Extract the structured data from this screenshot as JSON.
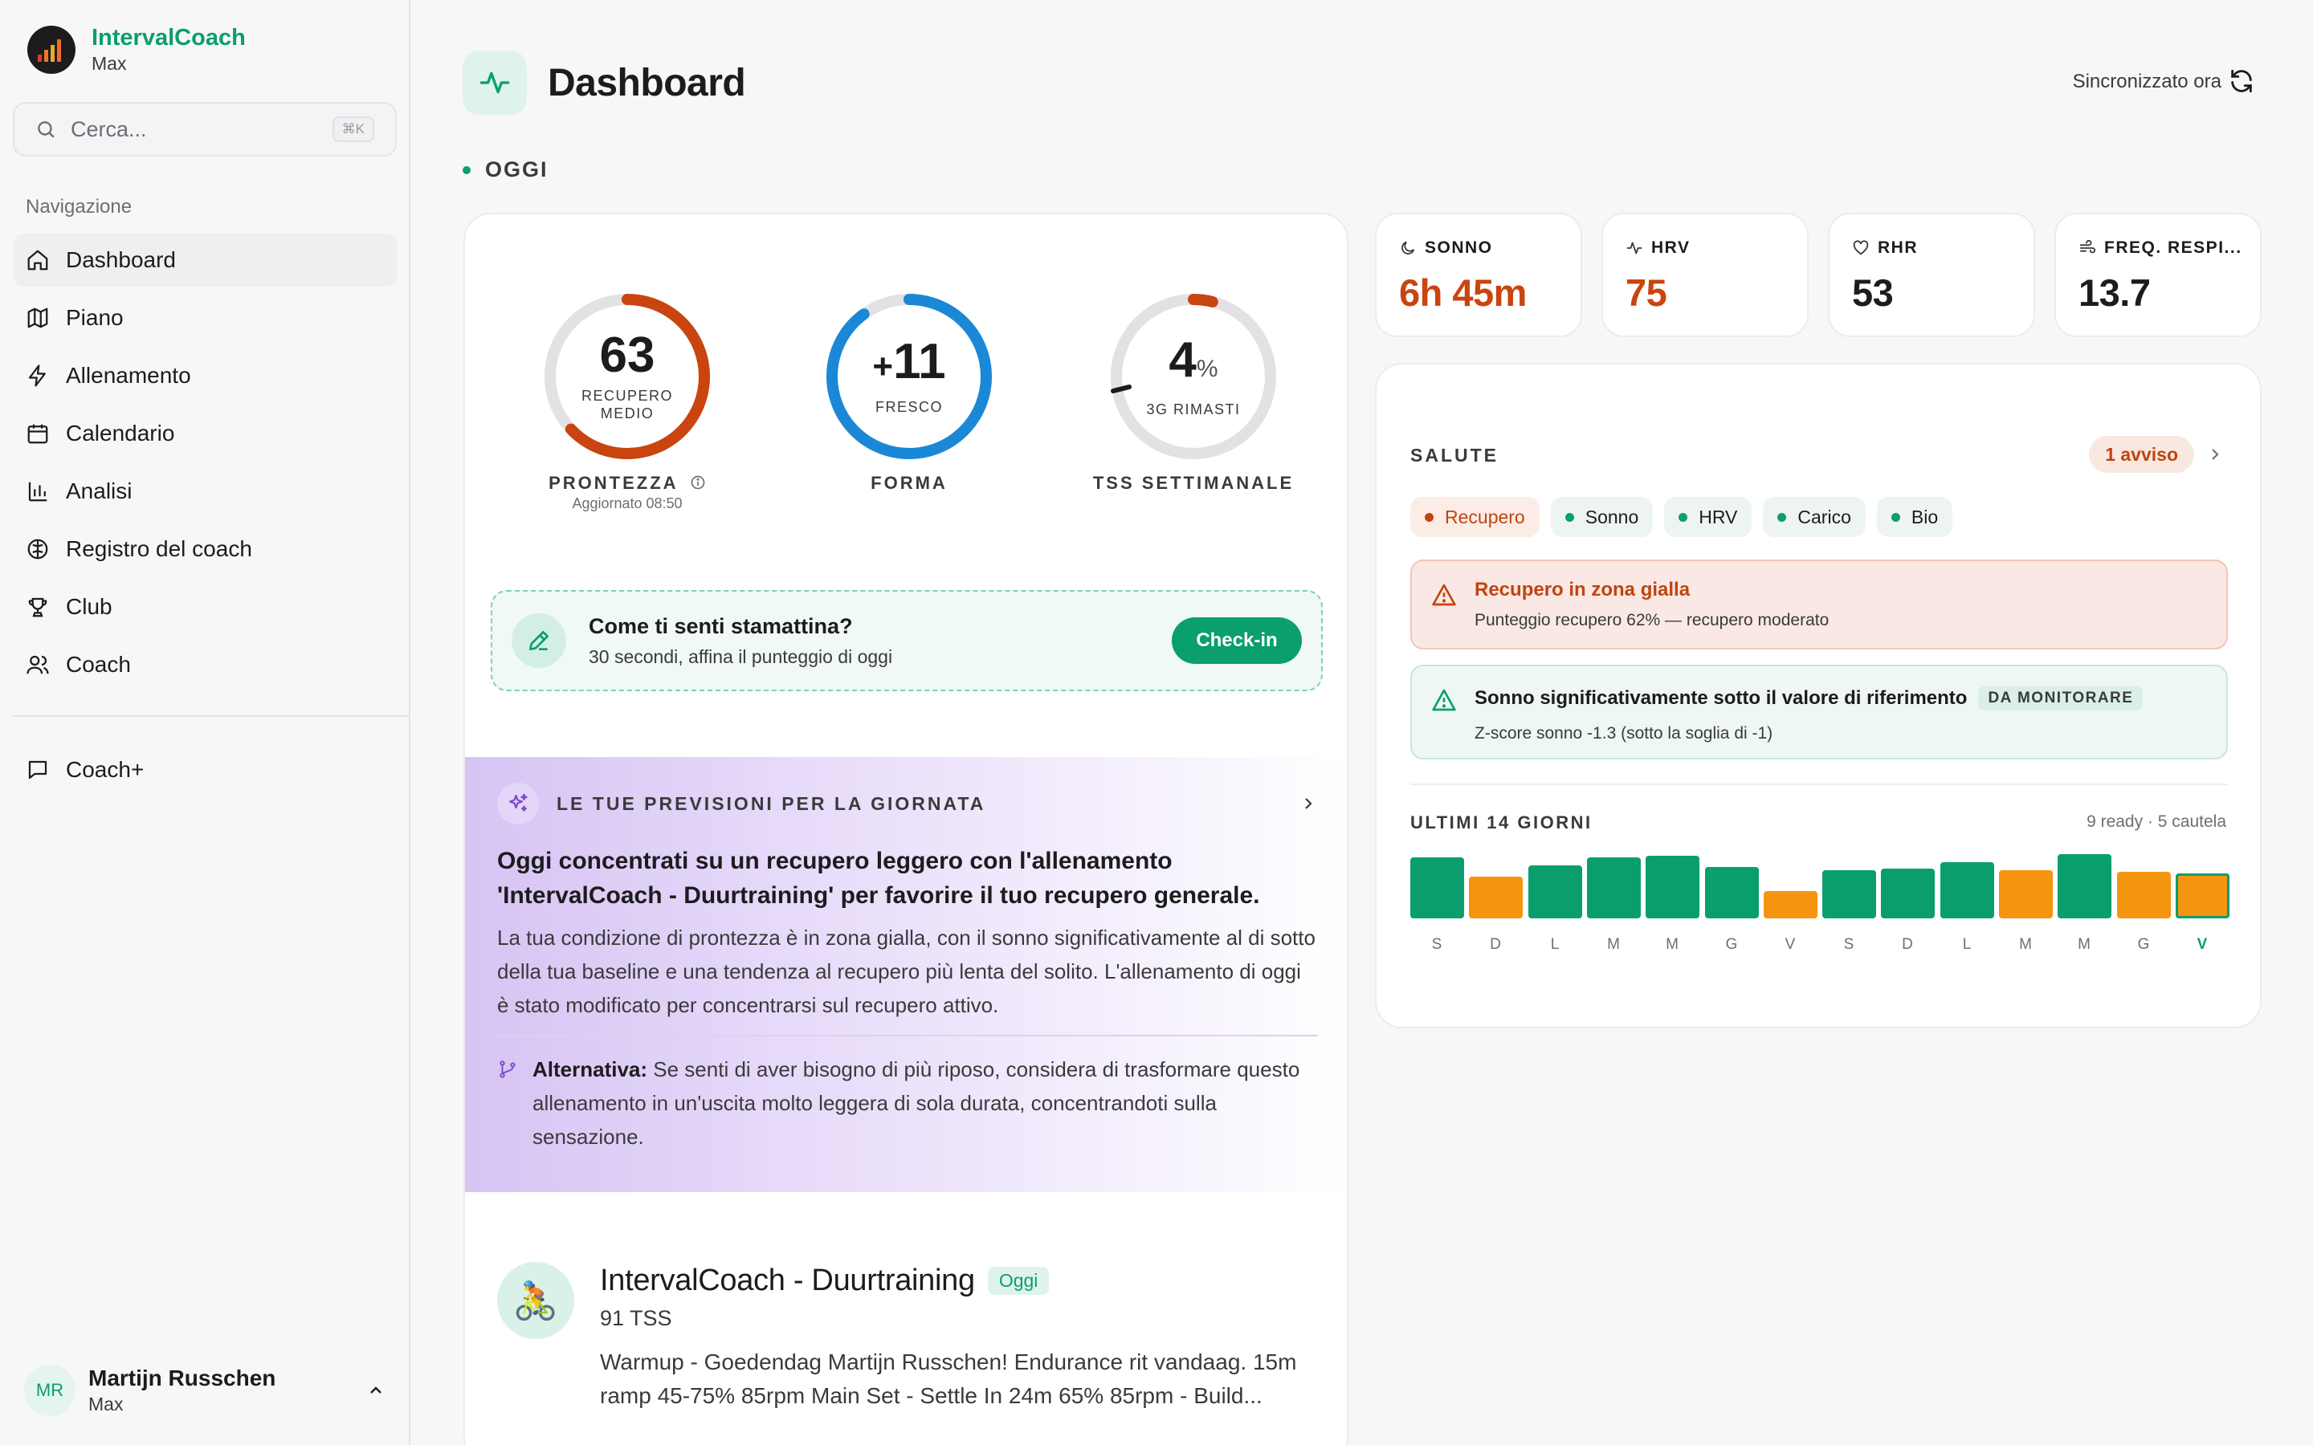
{
  "brand": {
    "name": "IntervalCoach",
    "plan": "Max"
  },
  "search": {
    "placeholder": "Cerca...",
    "shortcut": "⌘K"
  },
  "nav": {
    "section_label": "Navigazione",
    "items": [
      {
        "label": "Dashboard",
        "icon": "home-icon"
      },
      {
        "label": "Piano",
        "icon": "map-icon"
      },
      {
        "label": "Allenamento",
        "icon": "lightning-icon"
      },
      {
        "label": "Calendario",
        "icon": "calendar-icon"
      },
      {
        "label": "Analisi",
        "icon": "bar-chart-icon"
      },
      {
        "label": "Registro del coach",
        "icon": "brain-icon"
      },
      {
        "label": "Club",
        "icon": "trophy-icon"
      },
      {
        "label": "Coach",
        "icon": "users-icon"
      }
    ],
    "active": "Dashboard",
    "coachplus": "Coach+"
  },
  "user": {
    "initials": "MR",
    "name": "Martijn Russchen",
    "plan": "Max"
  },
  "header": {
    "title": "Dashboard",
    "sync_status": "Sincronizzato ora"
  },
  "section": {
    "today": "OGGI"
  },
  "readiness": {
    "value": "63",
    "sub": "RECUPERO MEDIO",
    "label": "PRONTEZZA",
    "updated": "Aggiornato 08:50",
    "fraction": 0.63,
    "color": "#c9440f"
  },
  "form": {
    "sign": "+",
    "value": "11",
    "sub": "FRESCO",
    "label": "FORMA",
    "fraction": 0.9,
    "color": "#1a88d6"
  },
  "tss": {
    "value": "4",
    "unit": "%",
    "sub": "3G RIMASTI",
    "label": "TSS SETTIMANALE",
    "fraction": 0.04,
    "color": "#c9440f"
  },
  "checkin": {
    "title": "Come ti senti stamattina?",
    "subtitle": "30 secondi, affina il punteggio di oggi",
    "button": "Check-in"
  },
  "forecast": {
    "label": "LE TUE PREVISIONI PER LA GIORNATA",
    "title": "Oggi concentrati su un recupero leggero con l'allenamento 'IntervalCoach - Duurtraining' per favorire il tuo recupero generale.",
    "body": "La tua condizione di prontezza è in zona gialla, con il sonno significativamente al di sotto della tua baseline e una tendenza al recupero più lenta del solito. L'allenamento di oggi è stato modificato per concentrarsi sul recupero attivo.",
    "alt_label": "Alternativa:",
    "alt_text": "Se senti di aver bisogno di più riposo, considera di trasformare questo allenamento in un'uscita molto leggera di sola durata, concentrandoti sulla sensazione."
  },
  "workout": {
    "icon": "🚴",
    "title": "IntervalCoach - Duurtraining",
    "badge": "Oggi",
    "tss": "91 TSS",
    "description": "Warmup - Goedendag Martijn Russchen! Endurance rit vandaag. 15m ramp 45-75% 85rpm Main Set - Settle In 24m 65% 85rpm - Build..."
  },
  "metrics": [
    {
      "label": "SONNO",
      "value": "6h 45m",
      "color": "#c9440f",
      "icon": "moon-icon"
    },
    {
      "label": "HRV",
      "value": "75",
      "color": "#c9440f",
      "icon": "pulse-icon"
    },
    {
      "label": "RHR",
      "value": "53",
      "color": "#1c1c1e",
      "icon": "heart-icon"
    },
    {
      "label": "FREQ. RESPI...",
      "value": "13.7",
      "color": "#1c1c1e",
      "icon": "wind-icon"
    }
  ],
  "health": {
    "title": "SALUTE",
    "badge": "1 avviso",
    "chips": [
      {
        "label": "Recupero",
        "status": "warn"
      },
      {
        "label": "Sonno",
        "status": "ok"
      },
      {
        "label": "HRV",
        "status": "ok"
      },
      {
        "label": "Carico",
        "status": "ok"
      },
      {
        "label": "Bio",
        "status": "ok"
      }
    ],
    "alert1": {
      "title": "Recupero in zona gialla",
      "subtitle": "Punteggio recupero 62% — recupero moderato"
    },
    "alert2": {
      "title": "Sonno significativamente sotto il valore di riferimento",
      "badge": "DA MONITORARE",
      "subtitle": "Z-score sonno -1.3 (sotto la soglia di -1)"
    },
    "history_title": "ULTIMI 14 GIORNI",
    "history_summary": "9 ready · 5 cautela",
    "days": [
      {
        "day": "S",
        "status": "ready",
        "level": 0.95
      },
      {
        "day": "D",
        "status": "cautela",
        "level": 0.65
      },
      {
        "day": "L",
        "status": "ready",
        "level": 0.82
      },
      {
        "day": "M",
        "status": "ready",
        "level": 0.95
      },
      {
        "day": "M",
        "status": "ready",
        "level": 0.98
      },
      {
        "day": "G",
        "status": "ready",
        "level": 0.8
      },
      {
        "day": "V",
        "status": "cautela",
        "level": 0.42
      },
      {
        "day": "S",
        "status": "ready",
        "level": 0.75
      },
      {
        "day": "D",
        "status": "ready",
        "level": 0.78
      },
      {
        "day": "L",
        "status": "ready",
        "level": 0.88
      },
      {
        "day": "M",
        "status": "cautela",
        "level": 0.75
      },
      {
        "day": "M",
        "status": "ready",
        "level": 1.0
      },
      {
        "day": "G",
        "status": "cautela",
        "level": 0.72
      },
      {
        "day": "V",
        "status": "cautela",
        "level": 0.7,
        "current": true
      }
    ],
    "colors": {
      "ready": "#0a9e6e",
      "cautela": "#f5950f",
      "current": "#0b9e6e"
    }
  }
}
